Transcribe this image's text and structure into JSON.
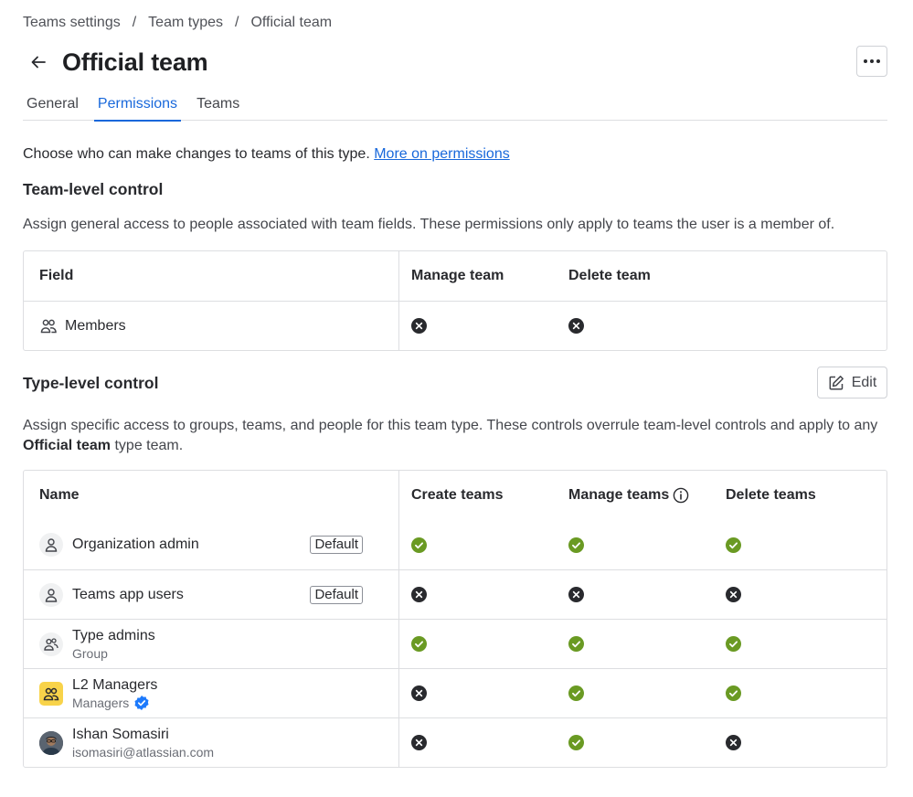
{
  "breadcrumb": [
    "Teams settings",
    "Team types",
    "Official team"
  ],
  "page": {
    "title": "Official team"
  },
  "tabs": [
    "General",
    "Permissions",
    "Teams"
  ],
  "intro": {
    "text": "Choose who can make changes to teams of this type. ",
    "link": "More on permissions"
  },
  "team_level": {
    "title": "Team-level control",
    "description": "Assign general access to people associated with team fields. These permissions only apply to teams the user is a member of.",
    "columns": [
      "Field",
      "Manage team",
      "Delete team"
    ],
    "rows": [
      {
        "field": "Members",
        "icon": "people-icon",
        "manage": "denied",
        "delete": "denied"
      }
    ]
  },
  "type_level": {
    "title": "Type-level control",
    "edit_label": "Edit",
    "description_a": "Assign specific access to groups, teams, and people for this team type. These controls overrule team-level controls and apply to any",
    "description_bold": "Official team",
    "description_b": " type team.",
    "columns": [
      "Name",
      "Create teams",
      "Manage teams",
      "Delete teams"
    ],
    "rows": [
      {
        "name": "Organization admin",
        "sub": "",
        "badge": "Default",
        "avatar": "person-icon",
        "create": "allowed",
        "manage": "allowed",
        "delete": "allowed"
      },
      {
        "name": "Teams app users",
        "sub": "",
        "badge": "Default",
        "avatar": "person-icon",
        "create": "denied",
        "manage": "denied",
        "delete": "denied"
      },
      {
        "name": "Type admins",
        "sub": "Group",
        "badge": "",
        "avatar": "group-icon",
        "create": "allowed",
        "manage": "allowed",
        "delete": "allowed"
      },
      {
        "name": "L2 Managers",
        "sub": "Managers",
        "badge": "",
        "avatar": "team-icon",
        "verified": true,
        "create": "denied",
        "manage": "allowed",
        "delete": "allowed"
      },
      {
        "name": "Ishan Somasiri",
        "sub": "isomasiri@atlassian.com",
        "badge": "",
        "avatar": "user-photo",
        "create": "denied",
        "manage": "allowed",
        "delete": "denied"
      }
    ]
  },
  "colors": {
    "allowed": "#6a9a23",
    "denied": "#292a2e",
    "link": "#1868db"
  }
}
